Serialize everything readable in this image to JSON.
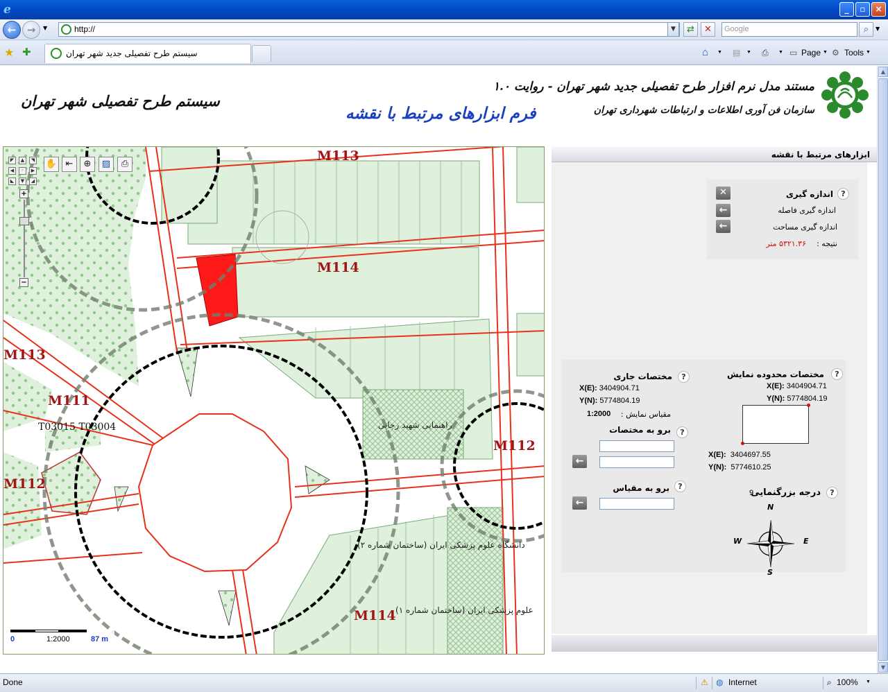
{
  "browser": {
    "url": "http://",
    "search_placeholder": "Google",
    "tab_title": "سیستم طرح تفصیلی جدید شهر تهران",
    "cmd_page": "Page",
    "cmd_tools": "Tools",
    "status_text": "Done",
    "zone": "Internet",
    "zoom": "100%"
  },
  "header": {
    "left_title": "سیستم طرح تفصیلی شهر تهران",
    "center_title": "فرم ابزارهای مرتبط با نقشه",
    "right_title": "مستند مدل نرم افزار طرح تفصیلی جدید شهر تهران - روایت ۱.۰",
    "right_subtitle": "سازمان فن آوری اطلاعات و ارتباطات شهرداری تهران"
  },
  "map": {
    "labels": [
      "M113",
      "M114",
      "M113",
      "M111",
      "M112",
      "M112",
      "M114"
    ],
    "parcel_codes": "T03015 T03004",
    "building_1": "راهنمایی شهید رجایی",
    "building_2": "دانشگاه علوم پزشکی ایران (ساختمان شماره ۲)",
    "building_3": "علوم پزشکی ایران (ساختمان شماره ۱)",
    "scale_start": "0",
    "scale_ratio": "1:2000",
    "scale_end": "87 m"
  },
  "panel": {
    "title": "ابزارهای مرتبط با نقشه",
    "measure": {
      "title": "اندازه گیری",
      "distance": "اندازه گیری فاصله",
      "area": "اندازه گیری مساحت",
      "result_label": "نتیجه :",
      "result_value": "۵۳۲۱.۳۶ متر"
    },
    "extent": {
      "title": "مختصات محدوده نمایش",
      "max_x_label": "X(E):",
      "max_x": "3404904.71",
      "max_y_label": "Y(N):",
      "max_y": "5774804.19",
      "min_x_label": "X(E):",
      "min_x": "3404697.55",
      "min_y_label": "Y(N):",
      "min_y": "5774610.25"
    },
    "current": {
      "title": "مختصات جاری",
      "x_label": "X(E):",
      "x": "3404904.71",
      "y_label": "Y(N):",
      "y": "5774804.19",
      "scale_label": "مقیاس نمایش :",
      "scale": "1:2000"
    },
    "goto_coord": {
      "title": "برو به مختصات"
    },
    "goto_scale": {
      "title": "برو به مقیاس"
    },
    "zoom": {
      "title": "درجه بزرگنمایی",
      "value": "9"
    },
    "compass": {
      "n": "N",
      "s": "S",
      "e": "E",
      "w": "W"
    }
  }
}
